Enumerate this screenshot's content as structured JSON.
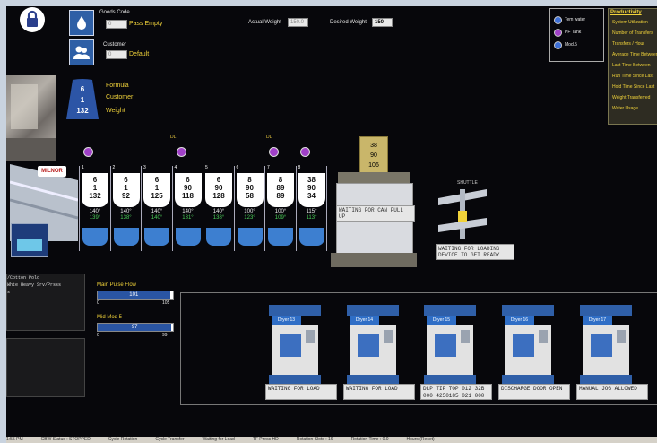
{
  "top": {
    "goods_code_label": "Goods Code",
    "goods_code_value": "0",
    "pass_empty_label": "Pass Empty",
    "customer_label": "Customer",
    "customer_value": "0",
    "default_label": "Default",
    "actual_weight_label": "Actual Weight",
    "actual_weight_value": "150.0",
    "desired_weight_label": "Desired Weight",
    "desired_weight_value": "150"
  },
  "legend": [
    {
      "label": "Tem water",
      "color": "#3d6fd6"
    },
    {
      "label": "PF Tank",
      "color": "#a040c8"
    },
    {
      "label": "Mod.5",
      "color": "#3d6fd6"
    }
  ],
  "productivity": {
    "title": "Productivity",
    "items": [
      "System Utilization",
      "Number of Transfers",
      "Transfers / Hour",
      "Average Time Between",
      "Last Time Between",
      "Run Time Since Last",
      "Hold Time Since Last",
      "Weight Transferred",
      "Water Usage"
    ]
  },
  "loading_bag": {
    "formula": "6",
    "customer": "1",
    "weight": "132",
    "formula_label": "Formula",
    "customer_label": "Customer",
    "weight_label": "Weight"
  },
  "brand": "MILNOR",
  "washers": [
    {
      "num": "1",
      "f": "6",
      "c": "1",
      "w": "132",
      "t1": "140°",
      "t2": "139°"
    },
    {
      "num": "2",
      "f": "6",
      "c": "1",
      "w": "92",
      "t1": "140°",
      "t2": "138°"
    },
    {
      "num": "3",
      "f": "6",
      "c": "1",
      "w": "125",
      "t1": "140°",
      "t2": "140°"
    },
    {
      "num": "4",
      "f": "6",
      "c": "90",
      "w": "118",
      "t1": "140°",
      "t2": "131°"
    },
    {
      "num": "5",
      "f": "6",
      "c": "90",
      "w": "128",
      "t1": "140°",
      "t2": "138°"
    },
    {
      "num": "6",
      "f": "8",
      "c": "90",
      "w": "58",
      "t1": "100°",
      "t2": "123°"
    },
    {
      "num": "7",
      "f": "8",
      "c": "89",
      "w": "89",
      "t1": "100°",
      "t2": "109°"
    },
    {
      "num": "8",
      "f": "38",
      "c": "90",
      "w": "34",
      "t1": "115°",
      "t2": "113°"
    }
  ],
  "valve_labels": [
    "DL",
    "DL"
  ],
  "press": {
    "f": "38",
    "c": "90",
    "w": "106",
    "message": "WAITING FOR CAN FULL UP"
  },
  "shuttle": {
    "label": "SHUTTLE",
    "message": "WAITING FOR LOADING DEVICE TO GET READY"
  },
  "left_panel": {
    "line1": "/Cotton Polo",
    "line2": "Whte Heavy Srv/Prsss",
    "line3": "s"
  },
  "flows": [
    {
      "label": "Main Pulse Flow",
      "value": "101",
      "min": "0",
      "max": "105",
      "fraction": 0.96
    },
    {
      "label": "Mid Mod 5",
      "value": "97",
      "min": "0",
      "max": "99",
      "fraction": 0.98
    }
  ],
  "dryers": [
    {
      "name": "Dryer 13",
      "status": "WAITING FOR LOAD"
    },
    {
      "name": "Dryer 14",
      "status": "WAITING FOR LOAD"
    },
    {
      "name": "Dryer 15",
      "status": "DLP TIP TOP 012 32B 000 4250185 021 000"
    },
    {
      "name": "Dryer 16",
      "status": "DISCHARGE DOOR OPEN"
    },
    {
      "name": "Dryer 17",
      "status": "MANUAL JOG ALLOWED"
    }
  ],
  "statusbar": [
    "1:55 PM",
    "CBW Status : STOPPED",
    "Cycle Rotation",
    "Cycle Transfer",
    "Waiting for Load",
    "TF Press HD",
    "Rotation Slots : 16",
    "Rotation Time : 0.0",
    "Hours (Reset)"
  ]
}
